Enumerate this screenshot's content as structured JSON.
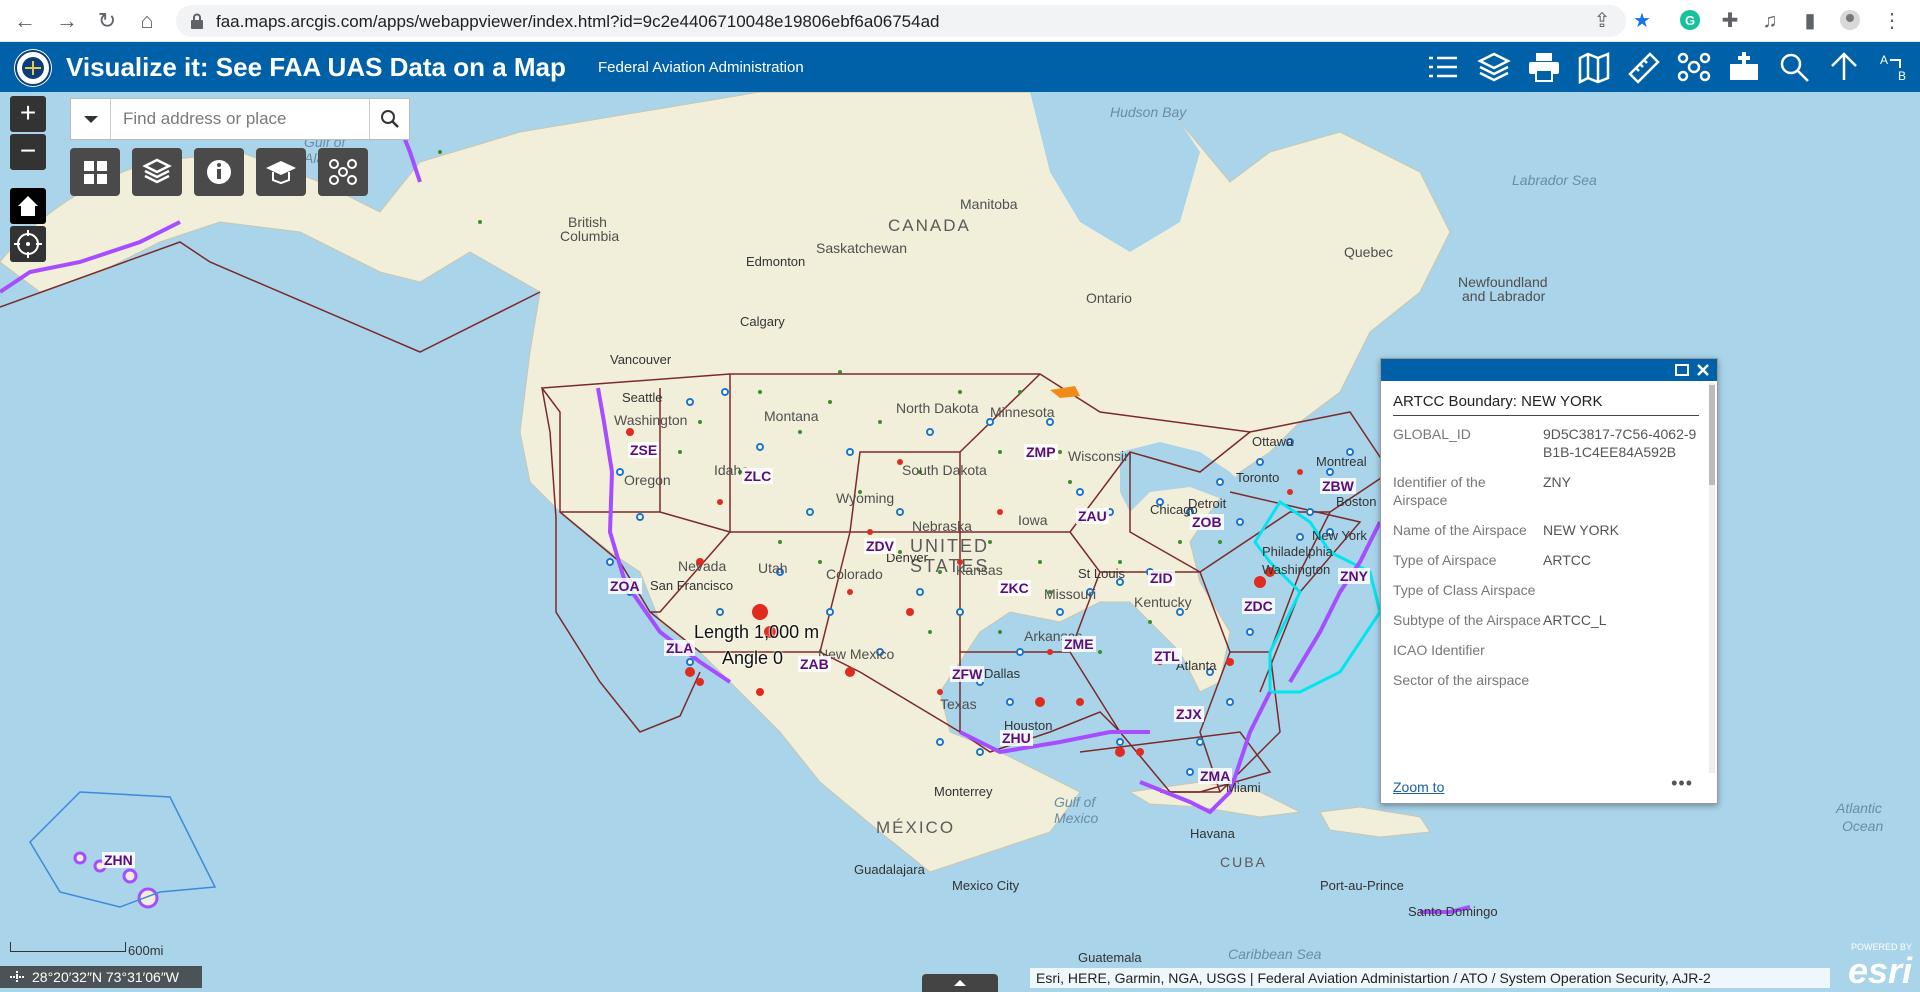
{
  "browser": {
    "url": "faa.maps.arcgis.com/apps/webappviewer/index.html?id=9c2e4406710048e19806ebf6a06754ad"
  },
  "header": {
    "title": "Visualize it: See FAA UAS Data on a Map",
    "subtitle": "Federal Aviation Administration"
  },
  "search": {
    "placeholder": "Find address or place"
  },
  "map_labels": {
    "countries": [
      "CANADA",
      "UNITED",
      "STATES",
      "MÉXICO",
      "CUBA"
    ],
    "oceans": [
      "Hudson Bay",
      "Labrador Sea",
      "Gulf of",
      "Mexico",
      "Atlantic",
      "Ocean",
      "Caribbean Sea",
      "Gulf of",
      "Alaska"
    ],
    "regions": [
      "British",
      "Columbia",
      "Saskatchewan",
      "Manitoba",
      "Ontario",
      "Quebec",
      "Newfoundland",
      "and Labrador",
      "North Dakota",
      "South Dakota",
      "Minnesota",
      "Wisconsin",
      "Montana",
      "Idaho",
      "Wyoming",
      "Nebraska",
      "Oregon",
      "Nevada",
      "Utah",
      "Colorado",
      "Kansas",
      "Missouri",
      "Arkansas",
      "Kentucky",
      "Iowa",
      "New Mexico",
      "Texas",
      "Washington"
    ],
    "cities": [
      "Edmonton",
      "Calgary",
      "Vancouver",
      "Seattle",
      "San Francisco",
      "Denver",
      "Dallas",
      "Houston",
      "Chicago",
      "Detroit",
      "St Louis",
      "Toronto",
      "Ottawa",
      "Montreal",
      "Boston",
      "New York",
      "Washington",
      "Philadelphia",
      "Atlanta",
      "Miami",
      "Havana",
      "Monterrey",
      "Guadalajara",
      "Mexico City",
      "Guatemala",
      "Port-au-Prince",
      "Santo Domingo"
    ]
  },
  "artcc": [
    "ZSE",
    "ZLC",
    "ZMP",
    "ZAU",
    "ZOB",
    "ZBW",
    "ZNY",
    "ZDV",
    "ZKC",
    "ZID",
    "ZDC",
    "ZOA",
    "ZLA",
    "ZAB",
    "ZFW",
    "ZME",
    "ZTL",
    "ZJX",
    "ZHU",
    "ZMA",
    "ZHN"
  ],
  "measure": {
    "length": "Length 1,000 m",
    "angle": "Angle 0"
  },
  "popup": {
    "title": "ARTCC Boundary: NEW YORK",
    "attributes": [
      {
        "name": "GLOBAL_ID",
        "value": "9D5C3817-7C56-4062-9B1B-1C4EE84A592B"
      },
      {
        "name": "Identifier of the Airspace",
        "value": "ZNY"
      },
      {
        "name": "Name of the Airspace",
        "value": "NEW YORK"
      },
      {
        "name": "Type of Airspace",
        "value": "ARTCC"
      },
      {
        "name": "Type of Class Airspace",
        "value": ""
      },
      {
        "name": "Subtype of the Airspace",
        "value": "ARTCC_L"
      },
      {
        "name": "ICAO Identifier",
        "value": ""
      },
      {
        "name": "Sector of the airspace",
        "value": ""
      }
    ],
    "zoom_to": "Zoom to",
    "more": "•••"
  },
  "scale": "600mi",
  "coordinates": "28°20′32″N 73°31′06″W",
  "attribution": "Esri, HERE, Garmin, NGA, USGS | Federal Aviation Administartion / ATO / System Operation Security, AJR-2",
  "esri": {
    "powered": "POWERED BY",
    "brand": "esri"
  },
  "colors": {
    "header": "#0061a8",
    "water": "#a9d4ea",
    "land": "#f1efd9",
    "boundary": "#7b2a2a",
    "artcc_highlight": "#00e5ee",
    "coastal_airspace": "#a64dff"
  }
}
